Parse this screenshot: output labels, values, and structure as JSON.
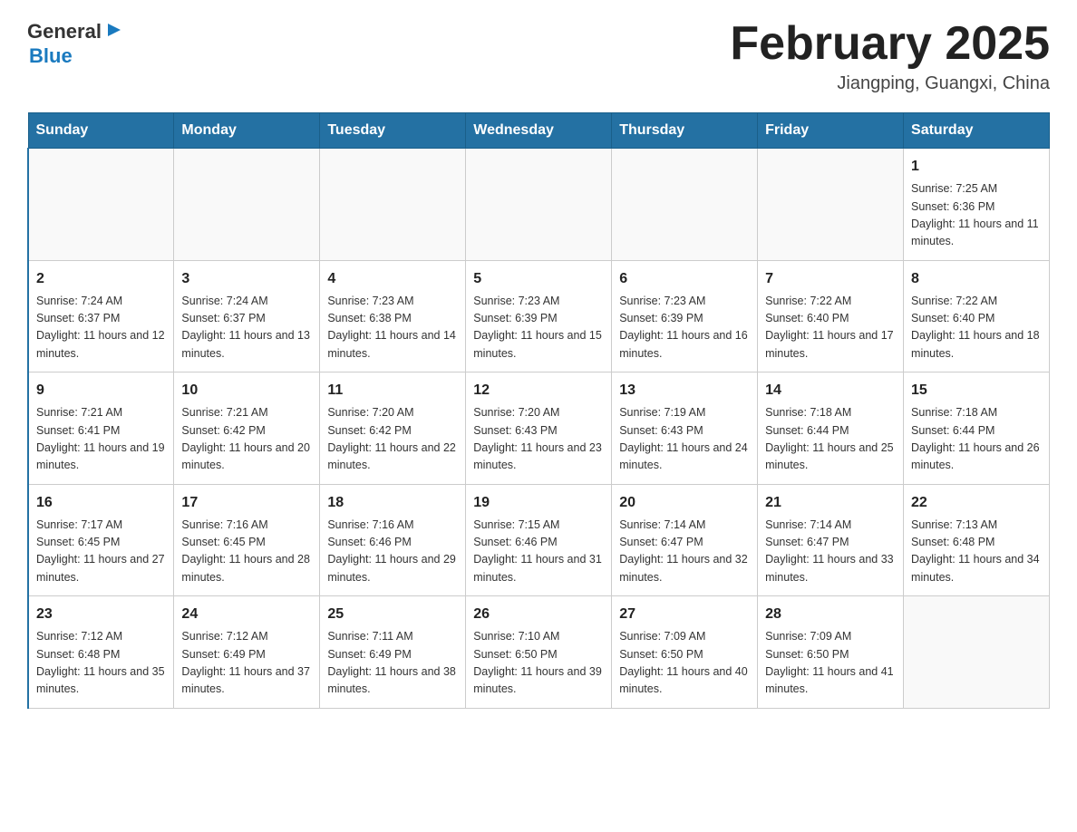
{
  "header": {
    "logo_general": "General",
    "logo_blue": "Blue",
    "month_title": "February 2025",
    "location": "Jiangping, Guangxi, China"
  },
  "days_of_week": [
    "Sunday",
    "Monday",
    "Tuesday",
    "Wednesday",
    "Thursday",
    "Friday",
    "Saturday"
  ],
  "weeks": [
    [
      {
        "day": "",
        "sunrise": "",
        "sunset": "",
        "daylight": ""
      },
      {
        "day": "",
        "sunrise": "",
        "sunset": "",
        "daylight": ""
      },
      {
        "day": "",
        "sunrise": "",
        "sunset": "",
        "daylight": ""
      },
      {
        "day": "",
        "sunrise": "",
        "sunset": "",
        "daylight": ""
      },
      {
        "day": "",
        "sunrise": "",
        "sunset": "",
        "daylight": ""
      },
      {
        "day": "",
        "sunrise": "",
        "sunset": "",
        "daylight": ""
      },
      {
        "day": "1",
        "sunrise": "Sunrise: 7:25 AM",
        "sunset": "Sunset: 6:36 PM",
        "daylight": "Daylight: 11 hours and 11 minutes."
      }
    ],
    [
      {
        "day": "2",
        "sunrise": "Sunrise: 7:24 AM",
        "sunset": "Sunset: 6:37 PM",
        "daylight": "Daylight: 11 hours and 12 minutes."
      },
      {
        "day": "3",
        "sunrise": "Sunrise: 7:24 AM",
        "sunset": "Sunset: 6:37 PM",
        "daylight": "Daylight: 11 hours and 13 minutes."
      },
      {
        "day": "4",
        "sunrise": "Sunrise: 7:23 AM",
        "sunset": "Sunset: 6:38 PM",
        "daylight": "Daylight: 11 hours and 14 minutes."
      },
      {
        "day": "5",
        "sunrise": "Sunrise: 7:23 AM",
        "sunset": "Sunset: 6:39 PM",
        "daylight": "Daylight: 11 hours and 15 minutes."
      },
      {
        "day": "6",
        "sunrise": "Sunrise: 7:23 AM",
        "sunset": "Sunset: 6:39 PM",
        "daylight": "Daylight: 11 hours and 16 minutes."
      },
      {
        "day": "7",
        "sunrise": "Sunrise: 7:22 AM",
        "sunset": "Sunset: 6:40 PM",
        "daylight": "Daylight: 11 hours and 17 minutes."
      },
      {
        "day": "8",
        "sunrise": "Sunrise: 7:22 AM",
        "sunset": "Sunset: 6:40 PM",
        "daylight": "Daylight: 11 hours and 18 minutes."
      }
    ],
    [
      {
        "day": "9",
        "sunrise": "Sunrise: 7:21 AM",
        "sunset": "Sunset: 6:41 PM",
        "daylight": "Daylight: 11 hours and 19 minutes."
      },
      {
        "day": "10",
        "sunrise": "Sunrise: 7:21 AM",
        "sunset": "Sunset: 6:42 PM",
        "daylight": "Daylight: 11 hours and 20 minutes."
      },
      {
        "day": "11",
        "sunrise": "Sunrise: 7:20 AM",
        "sunset": "Sunset: 6:42 PM",
        "daylight": "Daylight: 11 hours and 22 minutes."
      },
      {
        "day": "12",
        "sunrise": "Sunrise: 7:20 AM",
        "sunset": "Sunset: 6:43 PM",
        "daylight": "Daylight: 11 hours and 23 minutes."
      },
      {
        "day": "13",
        "sunrise": "Sunrise: 7:19 AM",
        "sunset": "Sunset: 6:43 PM",
        "daylight": "Daylight: 11 hours and 24 minutes."
      },
      {
        "day": "14",
        "sunrise": "Sunrise: 7:18 AM",
        "sunset": "Sunset: 6:44 PM",
        "daylight": "Daylight: 11 hours and 25 minutes."
      },
      {
        "day": "15",
        "sunrise": "Sunrise: 7:18 AM",
        "sunset": "Sunset: 6:44 PM",
        "daylight": "Daylight: 11 hours and 26 minutes."
      }
    ],
    [
      {
        "day": "16",
        "sunrise": "Sunrise: 7:17 AM",
        "sunset": "Sunset: 6:45 PM",
        "daylight": "Daylight: 11 hours and 27 minutes."
      },
      {
        "day": "17",
        "sunrise": "Sunrise: 7:16 AM",
        "sunset": "Sunset: 6:45 PM",
        "daylight": "Daylight: 11 hours and 28 minutes."
      },
      {
        "day": "18",
        "sunrise": "Sunrise: 7:16 AM",
        "sunset": "Sunset: 6:46 PM",
        "daylight": "Daylight: 11 hours and 29 minutes."
      },
      {
        "day": "19",
        "sunrise": "Sunrise: 7:15 AM",
        "sunset": "Sunset: 6:46 PM",
        "daylight": "Daylight: 11 hours and 31 minutes."
      },
      {
        "day": "20",
        "sunrise": "Sunrise: 7:14 AM",
        "sunset": "Sunset: 6:47 PM",
        "daylight": "Daylight: 11 hours and 32 minutes."
      },
      {
        "day": "21",
        "sunrise": "Sunrise: 7:14 AM",
        "sunset": "Sunset: 6:47 PM",
        "daylight": "Daylight: 11 hours and 33 minutes."
      },
      {
        "day": "22",
        "sunrise": "Sunrise: 7:13 AM",
        "sunset": "Sunset: 6:48 PM",
        "daylight": "Daylight: 11 hours and 34 minutes."
      }
    ],
    [
      {
        "day": "23",
        "sunrise": "Sunrise: 7:12 AM",
        "sunset": "Sunset: 6:48 PM",
        "daylight": "Daylight: 11 hours and 35 minutes."
      },
      {
        "day": "24",
        "sunrise": "Sunrise: 7:12 AM",
        "sunset": "Sunset: 6:49 PM",
        "daylight": "Daylight: 11 hours and 37 minutes."
      },
      {
        "day": "25",
        "sunrise": "Sunrise: 7:11 AM",
        "sunset": "Sunset: 6:49 PM",
        "daylight": "Daylight: 11 hours and 38 minutes."
      },
      {
        "day": "26",
        "sunrise": "Sunrise: 7:10 AM",
        "sunset": "Sunset: 6:50 PM",
        "daylight": "Daylight: 11 hours and 39 minutes."
      },
      {
        "day": "27",
        "sunrise": "Sunrise: 7:09 AM",
        "sunset": "Sunset: 6:50 PM",
        "daylight": "Daylight: 11 hours and 40 minutes."
      },
      {
        "day": "28",
        "sunrise": "Sunrise: 7:09 AM",
        "sunset": "Sunset: 6:50 PM",
        "daylight": "Daylight: 11 hours and 41 minutes."
      },
      {
        "day": "",
        "sunrise": "",
        "sunset": "",
        "daylight": ""
      }
    ]
  ]
}
